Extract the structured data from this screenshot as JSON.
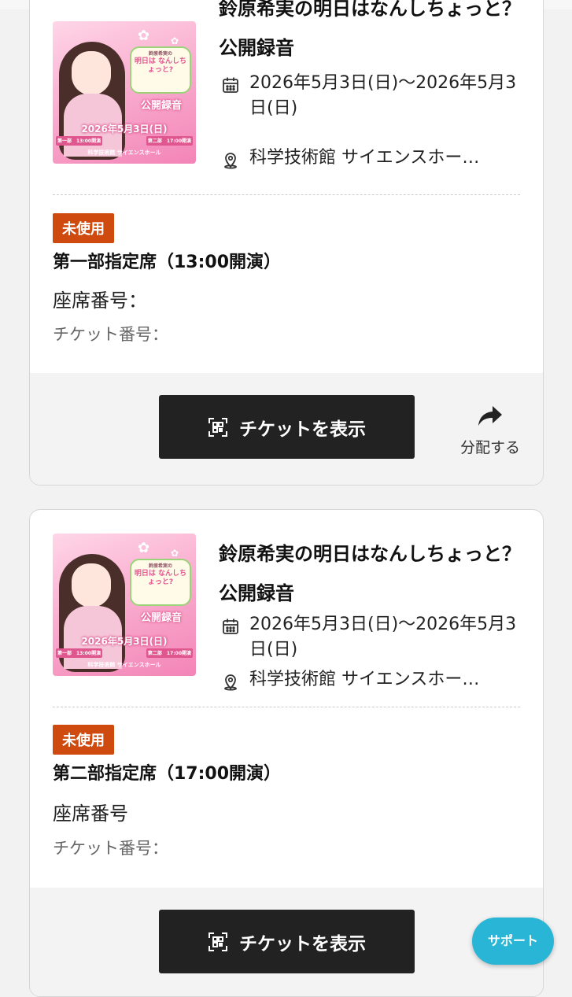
{
  "tickets": [
    {
      "thumbnail": {
        "bubble_sub": "鈴原希実の",
        "bubble_main": "明日は なんしちょっと?",
        "event_label": "公開録音",
        "date_label": "2026年5月3日(日)",
        "part1": "第一部　13:00開演",
        "part2": "第二部　17:00開演",
        "venue_small": "科学技術館 サイエンスホール"
      },
      "title": "鈴原希実の明日はなんしちょっと？ 公開録音",
      "date": "2026年5月3日(日)〜2026年5月3日(日)",
      "venue": "科学技術館 サイエンスホー…",
      "status": "未使用",
      "seat_type": "第一部指定席（13:00開演）",
      "seat_number_label": "座席番号：",
      "ticket_number_label": "チケット番号：",
      "show_button": "チケットを表示",
      "share_label": "分配する"
    },
    {
      "thumbnail": {
        "bubble_sub": "鈴原希実の",
        "bubble_main": "明日は なんしちょっと?",
        "event_label": "公開録音",
        "date_label": "2026年5月3日(日)",
        "part1": "第一部　13:00開演",
        "part2": "第二部　17:00開演",
        "venue_small": "科学技術館 サイエンスホール"
      },
      "title": "鈴原希実の明日はなんしちょっと？ 公開録音",
      "date": "2026年5月3日(日)〜2026年5月3日(日)",
      "venue": "科学技術館 サイエンスホー…",
      "status": "未使用",
      "seat_type": "第二部指定席（17:00開演）",
      "seat_number_label": "座席番号",
      "ticket_number_label": "チケット番号：",
      "show_button": "チケットを表示"
    }
  ],
  "support_button": "サポート",
  "colors": {
    "status_badge": "#cf4a0e",
    "button_bg": "#222222",
    "support_bg": "#29b6d6"
  },
  "icons": [
    "calendar-icon",
    "location-pin-icon",
    "qr-code-icon",
    "share-arrow-icon"
  ]
}
